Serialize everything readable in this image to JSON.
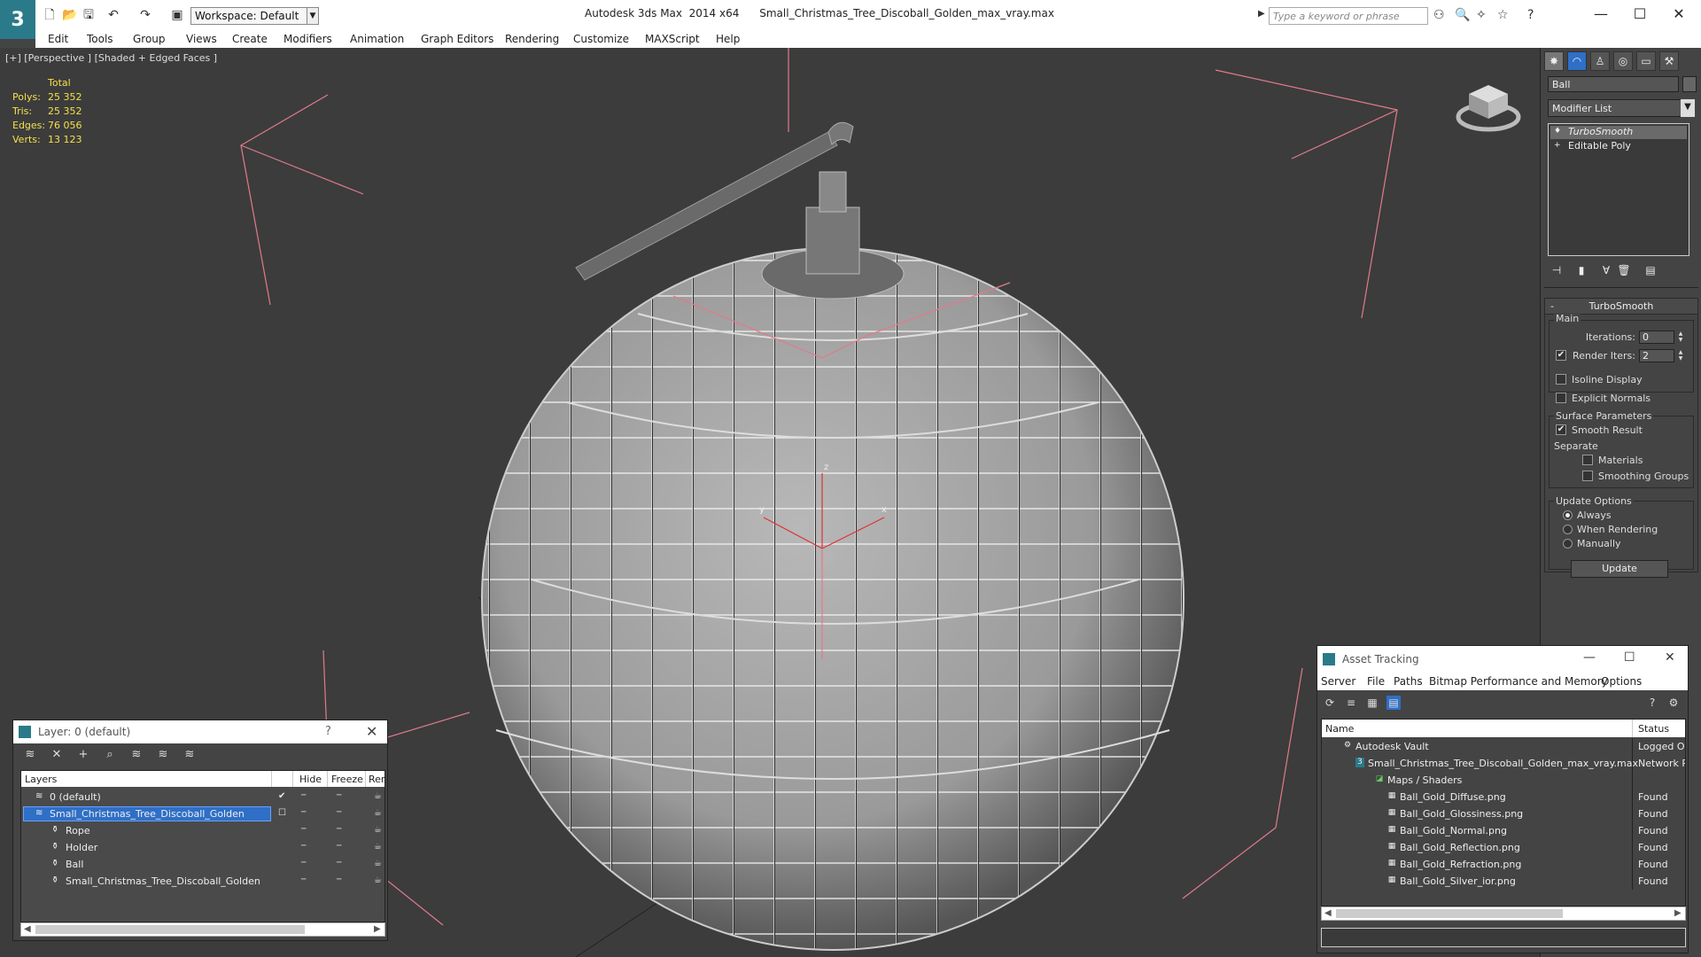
{
  "titlebar": {
    "logo": "3",
    "workspace": "Workspace: Default",
    "app_title": "Autodesk 3ds Max  2014 x64      Small_Christmas_Tree_Discoball_Golden_max_vray.max",
    "search_placeholder": "Type a keyword or phrase",
    "minimize": "—",
    "maximize": "☐",
    "close": "✕"
  },
  "menu": [
    "Edit",
    "Tools",
    "Group",
    "Views",
    "Create",
    "Modifiers",
    "Animation",
    "Graph Editors",
    "Rendering",
    "Customize",
    "MAXScript",
    "Help"
  ],
  "viewport": {
    "label": "[+] [Perspective ] [Shaded + Edged Faces ]",
    "stats_header": "Total",
    "stats": [
      {
        "k": "Polys:",
        "v": "25 352"
      },
      {
        "k": "Tris:",
        "v": "25 352"
      },
      {
        "k": "Edges:",
        "v": "76 056"
      },
      {
        "k": "Verts:",
        "v": "13 123"
      }
    ],
    "axis_x": "x",
    "axis_y": "y",
    "axis_z": "z"
  },
  "command_panel": {
    "object_name": "Ball",
    "modifier_list": "Modifier List",
    "stack": [
      {
        "label": "TurboSmooth",
        "selected": true
      },
      {
        "label": "Editable Poly",
        "selected": false
      }
    ],
    "turbosmooth": {
      "title": "TurboSmooth",
      "collapse": "-",
      "main_label": "Main",
      "iterations_label": "Iterations:",
      "iterations_value": "0",
      "render_iters_label": "Render Iters:",
      "render_iters_value": "2",
      "render_iters_checked": "✔",
      "isoline_label": "Isoline Display",
      "explicit_normals_label": "Explicit Normals",
      "surface_params_label": "Surface Parameters",
      "smooth_result_label": "Smooth Result",
      "smooth_result_checked": "✔",
      "separate_label": "Separate",
      "materials_label": "Materials",
      "smoothing_groups_label": "Smoothing Groups",
      "update_options_label": "Update Options",
      "always_label": "Always",
      "when_rendering_label": "When Rendering",
      "manually_label": "Manually",
      "update_button": "Update"
    }
  },
  "layer_window": {
    "title": "Layer: 0 (default)",
    "help": "?",
    "close": "✕",
    "columns": {
      "layers": "Layers",
      "hide": "Hide",
      "freeze": "Freeze",
      "render": "Ren"
    },
    "rows": [
      {
        "name": "0 (default)",
        "indent": 1
      },
      {
        "name": "Small_Christmas_Tree_Discoball_Golden",
        "indent": 1
      },
      {
        "name": "Rope",
        "indent": 2
      },
      {
        "name": "Holder",
        "indent": 2
      },
      {
        "name": "Ball",
        "indent": 2
      },
      {
        "name": "Small_Christmas_Tree_Discoball_Golden",
        "indent": 2
      }
    ],
    "check_mark": "✔"
  },
  "asset_tracking": {
    "title": "Asset Tracking",
    "minimize": "—",
    "maximize": "☐",
    "close": "✕",
    "menu": [
      "Server",
      "File",
      "Paths",
      "Bitmap Performance and Memory",
      "Options"
    ],
    "columns": {
      "name": "Name",
      "status": "Status"
    },
    "rows": [
      {
        "name": "Autodesk Vault",
        "status": "Logged Or"
      },
      {
        "name": "Small_Christmas_Tree_Discoball_Golden_max_vray.max",
        "status": "Network P"
      },
      {
        "name": "Maps / Shaders",
        "status": ""
      },
      {
        "name": "Ball_Gold_Diffuse.png",
        "status": "Found"
      },
      {
        "name": "Ball_Gold_Glossiness.png",
        "status": "Found"
      },
      {
        "name": "Ball_Gold_Normal.png",
        "status": "Found"
      },
      {
        "name": "Ball_Gold_Reflection.png",
        "status": "Found"
      },
      {
        "name": "Ball_Gold_Refraction.png",
        "status": "Found"
      },
      {
        "name": "Ball_Gold_Silver_ior.png",
        "status": "Found"
      }
    ]
  },
  "icons": {
    "new": "🗋",
    "open": "📂",
    "save": "🖫",
    "undo": "↶",
    "redo": "↷",
    "search": "🔍",
    "star": "☆",
    "help": "?",
    "scroll_left": "◀",
    "scroll_right": "▶"
  },
  "colors": {
    "stats_yellow": "#f5e04a",
    "selection_blue": "#2f6fc7",
    "brand_teal": "#2a7a8a"
  }
}
